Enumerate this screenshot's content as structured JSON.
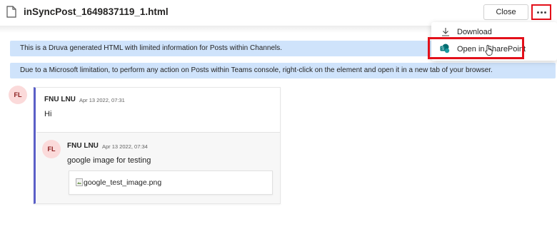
{
  "header": {
    "file_title": "inSyncPost_1649837119_1.html",
    "close_label": "Close",
    "more_icon": "more-horizontal-icon"
  },
  "menu": {
    "download_label": "Download",
    "sharepoint_label": "Open in SharePoint"
  },
  "banners": [
    "This is a Druva generated HTML with limited information for Posts within Channels.",
    "Due to a Microsoft limitation, to perform any action on Posts within Teams console, right-click on the element and open it in a new tab of your browser."
  ],
  "post": {
    "avatar": "FL",
    "author": "FNU LNU",
    "time": "Apr 13 2022, 07:31",
    "message": "Hi"
  },
  "reply": {
    "avatar": "FL",
    "author": "FNU LNU",
    "time": "Apr 13 2022, 07:34",
    "message": "google image for testing",
    "image_alt": "google_test_image.png"
  },
  "colors": {
    "highlight": "#e3101a",
    "banner_bg": "#cfe3fb",
    "accent": "#5b5fc7",
    "avatar_bg": "#fbdada"
  }
}
